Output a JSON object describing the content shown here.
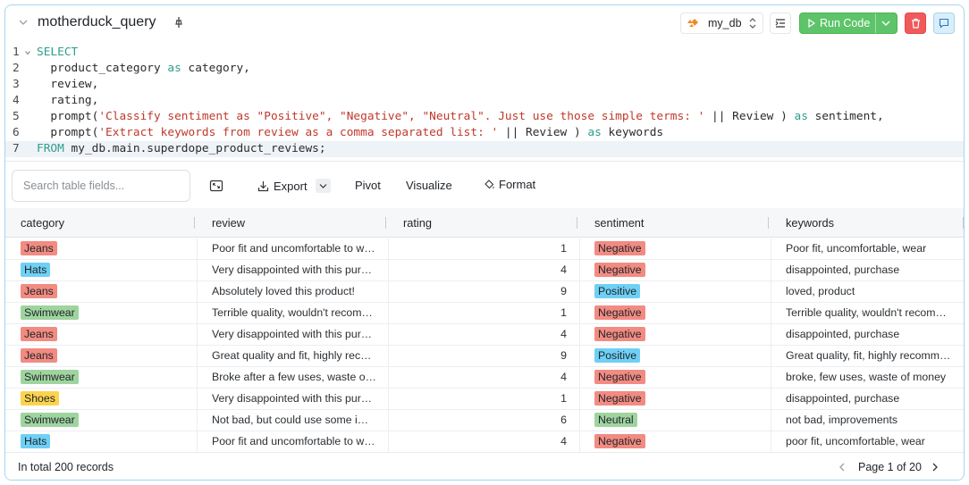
{
  "cell": {
    "title": "motherduck_query",
    "database": "my_db",
    "run_label": "Run Code",
    "icons": {
      "collapse": "chevron-down-icon",
      "pin": "pin-icon",
      "db": "motherduck-logo-icon",
      "db_arrows": "chevron-updown-icon",
      "format": "indent-icon",
      "run": "play-icon",
      "run_menu": "chevron-down-icon",
      "delete": "trash-icon",
      "comment": "comment-icon"
    },
    "colors": {
      "run": "#5ec46a",
      "delete": "#f05a5a",
      "comment": "#d9eefb"
    }
  },
  "code": {
    "active_line": 7,
    "lines": [
      {
        "n": "1",
        "tokens": [
          {
            "t": "SELECT",
            "k": "kw"
          }
        ]
      },
      {
        "n": "2",
        "tokens": [
          {
            "t": "  product_category ",
            "k": ""
          },
          {
            "t": "as",
            "k": "kw"
          },
          {
            "t": " category,",
            "k": ""
          }
        ]
      },
      {
        "n": "3",
        "tokens": [
          {
            "t": "  review,",
            "k": ""
          }
        ]
      },
      {
        "n": "4",
        "tokens": [
          {
            "t": "  rating,",
            "k": ""
          }
        ]
      },
      {
        "n": "5",
        "tokens": [
          {
            "t": "  prompt(",
            "k": ""
          },
          {
            "t": "'Classify sentiment as \"Positive\", \"Negative\", \"Neutral\". Just use those simple terms: '",
            "k": "str"
          },
          {
            "t": " || Review ) ",
            "k": ""
          },
          {
            "t": "as",
            "k": "kw"
          },
          {
            "t": " sentiment,",
            "k": ""
          }
        ]
      },
      {
        "n": "6",
        "tokens": [
          {
            "t": "  prompt(",
            "k": ""
          },
          {
            "t": "'Extract keywords from review as a comma separated list: '",
            "k": "str"
          },
          {
            "t": " || Review ) ",
            "k": ""
          },
          {
            "t": "as",
            "k": "kw"
          },
          {
            "t": " keywords",
            "k": ""
          }
        ]
      },
      {
        "n": "7",
        "tokens": [
          {
            "t": "FROM",
            "k": "kw"
          },
          {
            "t": " my_db.main.superdope_product_reviews;",
            "k": ""
          }
        ]
      }
    ]
  },
  "toolbar": {
    "search_placeholder": "Search table fields...",
    "export": "Export",
    "pivot": "Pivot",
    "visualize": "Visualize",
    "format": "Format",
    "icons": {
      "expand": "expand-icon",
      "export": "download-icon",
      "format": "paint-bucket-icon"
    }
  },
  "table": {
    "columns": [
      "category",
      "review",
      "rating",
      "sentiment",
      "keywords"
    ],
    "category_colors": {
      "Jeans": "#f28b82",
      "Hats": "#6fd0f5",
      "Swimwear": "#9fd49f",
      "Shoes": "#fcd34d"
    },
    "sentiment_colors": {
      "Negative": "#f28b82",
      "Positive": "#6fd0f5",
      "Neutral": "#9fd49f"
    },
    "rows": [
      {
        "category": "Jeans",
        "review": "Poor fit and uncomfortable to wear.",
        "rating": "1",
        "sentiment": "Negative",
        "keywords": "Poor fit, uncomfortable, wear"
      },
      {
        "category": "Hats",
        "review": "Very disappointed with this purchase.",
        "rating": "4",
        "sentiment": "Negative",
        "keywords": "disappointed, purchase"
      },
      {
        "category": "Jeans",
        "review": "Absolutely loved this product!",
        "rating": "9",
        "sentiment": "Positive",
        "keywords": "loved, product"
      },
      {
        "category": "Swimwear",
        "review": "Terrible quality, wouldn't recommend.",
        "rating": "1",
        "sentiment": "Negative",
        "keywords": "Terrible quality, wouldn't recommend"
      },
      {
        "category": "Jeans",
        "review": "Very disappointed with this purchase.",
        "rating": "4",
        "sentiment": "Negative",
        "keywords": "disappointed, purchase"
      },
      {
        "category": "Jeans",
        "review": "Great quality and fit, highly recommend.",
        "rating": "9",
        "sentiment": "Positive",
        "keywords": "Great quality, fit, highly recommend"
      },
      {
        "category": "Swimwear",
        "review": "Broke after a few uses, waste of money.",
        "rating": "4",
        "sentiment": "Negative",
        "keywords": "broke, few uses, waste of money"
      },
      {
        "category": "Shoes",
        "review": "Very disappointed with this purchase.",
        "rating": "1",
        "sentiment": "Negative",
        "keywords": "disappointed, purchase"
      },
      {
        "category": "Swimwear",
        "review": "Not bad, but could use some improvements.",
        "rating": "6",
        "sentiment": "Neutral",
        "keywords": "not bad, improvements"
      },
      {
        "category": "Hats",
        "review": "Poor fit and uncomfortable to wear.",
        "rating": "4",
        "sentiment": "Negative",
        "keywords": "poor fit, uncomfortable, wear"
      }
    ]
  },
  "footer": {
    "total": "In total 200 records",
    "page": "Page 1 of 20",
    "icons": {
      "prev": "chevron-left-icon",
      "next": "chevron-right-icon"
    }
  }
}
